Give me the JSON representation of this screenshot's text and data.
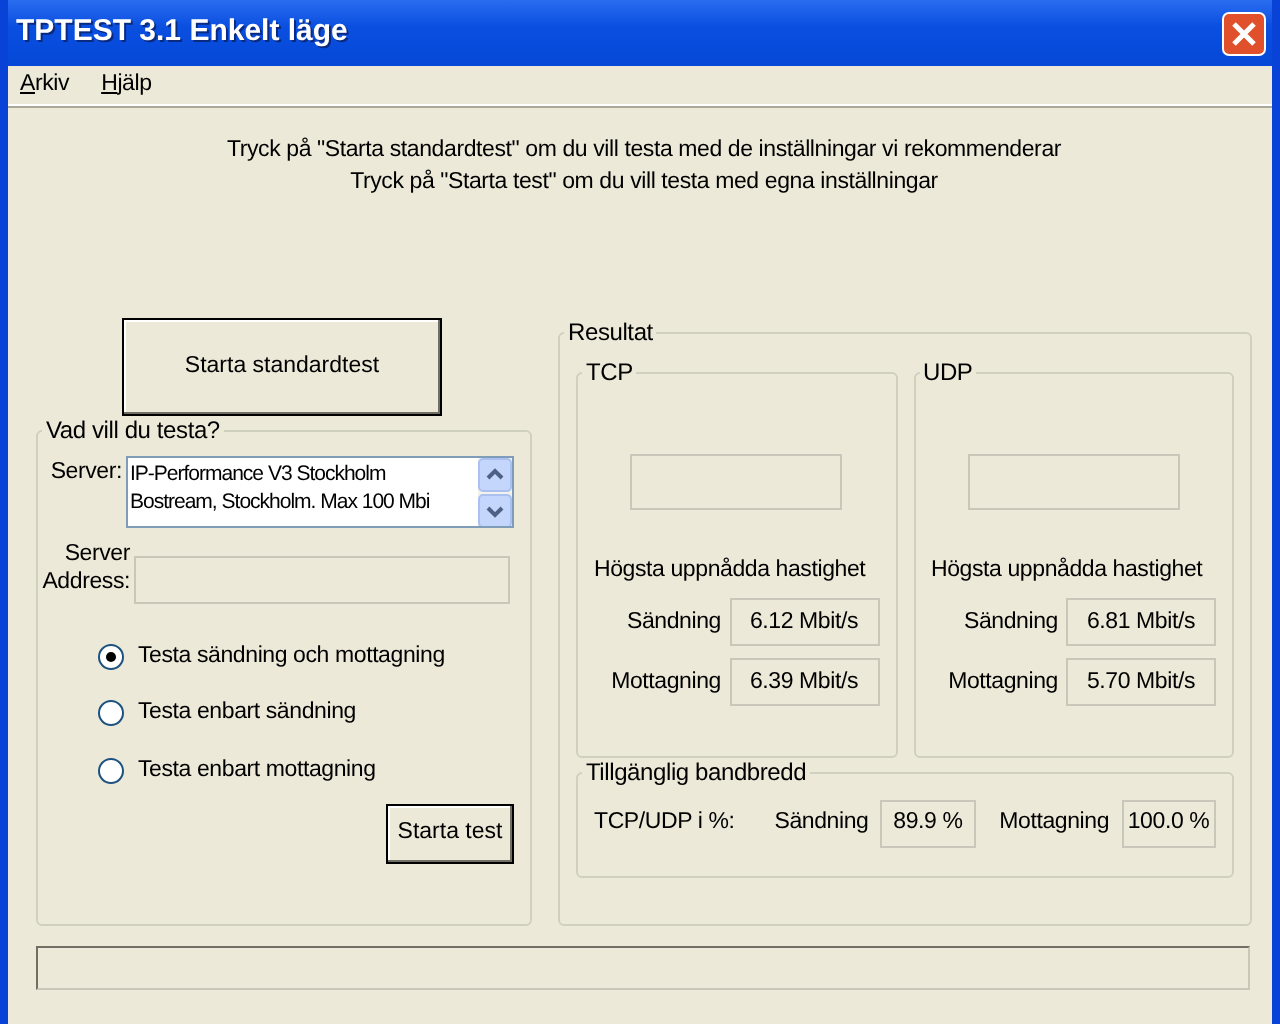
{
  "window": {
    "title": "TPTEST 3.1 Enkelt läge"
  },
  "menu": [
    {
      "label": "Arkiv"
    },
    {
      "label": "Hjälp"
    }
  ],
  "instructions": [
    "Tryck på \"Starta standardtest\" om du vill testa med de inställningar vi rekommenderar",
    "Tryck på \"Starta test\" om du vill testa med egna inställningar"
  ],
  "standard_button": "Starta standardtest",
  "test_options": {
    "title": "Vad vill du testa?",
    "server_label": "Server:",
    "servers": [
      {
        "label": "IP-Performance V3 Stockholm"
      },
      {
        "label": "Bostream, Stockholm. Max 100 Mbi"
      }
    ],
    "address_label": "Server Address:",
    "modes": [
      {
        "label": "Testa sändning och mottagning",
        "selected": true
      },
      {
        "label": "Testa enbart sändning",
        "selected": false
      },
      {
        "label": "Testa enbart mottagning",
        "selected": false
      }
    ],
    "start_button": "Starta test"
  },
  "results": {
    "title": "Resultat",
    "protocols": [
      {
        "name": "TCP",
        "heading": "Högsta uppnådda hastighet",
        "send_label": "Sändning",
        "send_value": "6.12 Mbit/s",
        "receive_label": "Mottagning",
        "receive_value": "6.39 Mbit/s"
      },
      {
        "name": "UDP",
        "heading": "Högsta uppnådda hastighet",
        "send_label": "Sändning",
        "send_value": "6.81 Mbit/s",
        "receive_label": "Mottagning",
        "receive_value": "5.70 Mbit/s"
      }
    ],
    "bandwidth": {
      "title": "Tillgänglig bandbredd",
      "label": "TCP/UDP i %:",
      "send_label": "Sändning",
      "send_value": "89.9 %",
      "receive_label": "Mottagning",
      "receive_value": "100.0 %"
    }
  }
}
